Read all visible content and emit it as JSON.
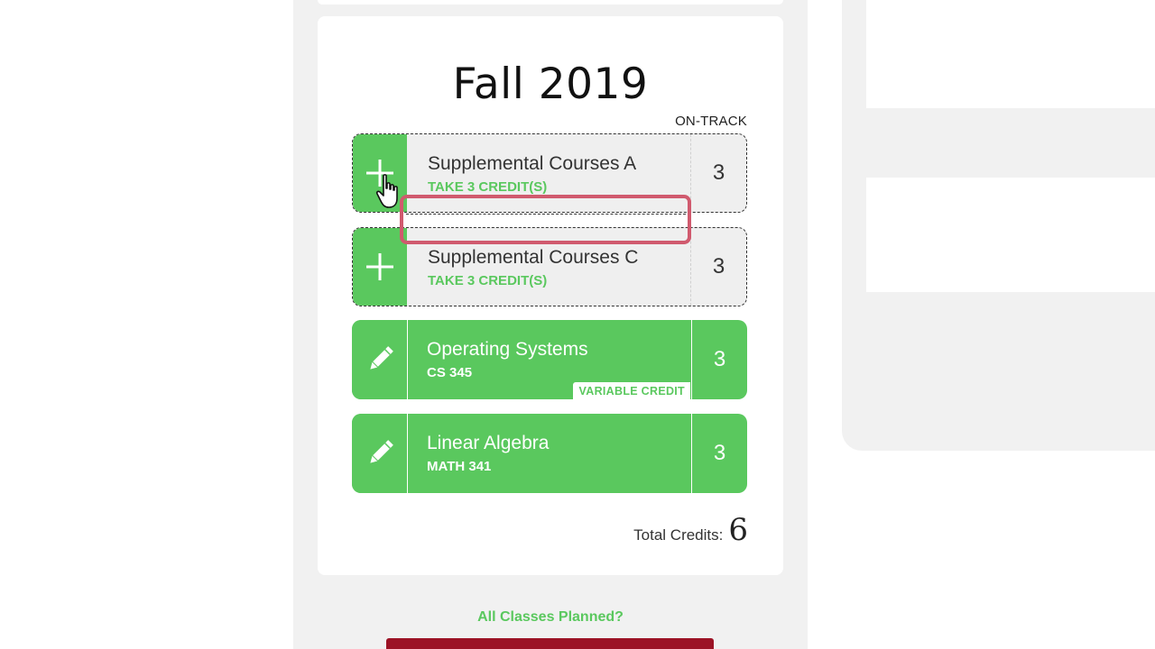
{
  "semester": {
    "title": "Fall 2019",
    "status": "ON-TRACK"
  },
  "courses": [
    {
      "kind": "placeholder",
      "name": "Supplemental Courses A",
      "sub": "TAKE 3 CREDIT(S)",
      "credits": "3",
      "icon": "plus-icon"
    },
    {
      "kind": "placeholder",
      "name": "Supplemental Courses C",
      "sub": "TAKE 3 CREDIT(S)",
      "credits": "3",
      "icon": "plus-icon"
    },
    {
      "kind": "planned",
      "name": "Operating Systems",
      "sub": "CS 345",
      "credits": "3",
      "badge": "VARIABLE CREDIT",
      "icon": "pencil-icon"
    },
    {
      "kind": "planned",
      "name": "Linear Algebra",
      "sub": "MATH 341",
      "credits": "3",
      "icon": "pencil-icon"
    }
  ],
  "totals": {
    "label": "Total Credits:",
    "value": "6"
  },
  "footer": {
    "planned_link": "All Classes Planned?"
  },
  "colors": {
    "accent_green": "#5ac85e",
    "highlight": "#d05a6e",
    "button_red": "#9c1225",
    "panel_gray": "#f1f1f1"
  }
}
